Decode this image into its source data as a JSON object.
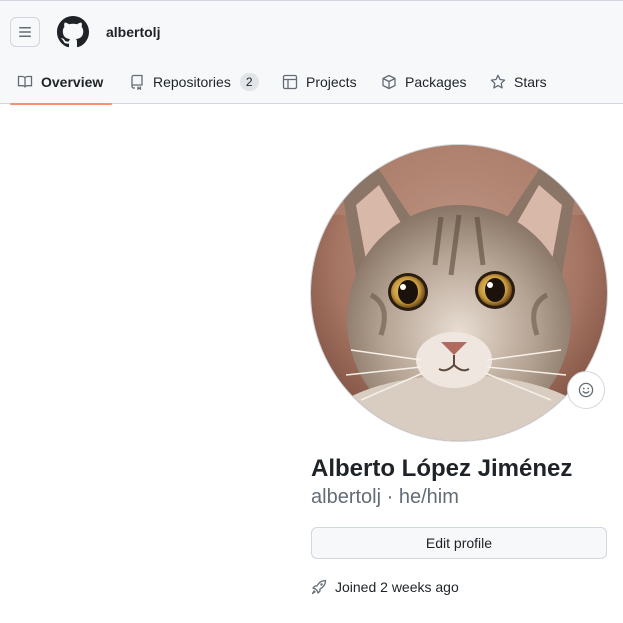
{
  "header": {
    "username": "albertolj",
    "menu_icon": "hamburger-icon",
    "logo_icon": "github-mark-icon"
  },
  "tabs": [
    {
      "label": "Overview",
      "icon": "book-icon",
      "active": true
    },
    {
      "label": "Repositories",
      "icon": "repo-icon",
      "count": "2"
    },
    {
      "label": "Projects",
      "icon": "table-icon"
    },
    {
      "label": "Packages",
      "icon": "package-icon"
    },
    {
      "label": "Stars",
      "icon": "star-icon"
    }
  ],
  "profile": {
    "full_name": "Alberto López Jiménez",
    "login": "albertolj",
    "separator": "·",
    "pronouns": "he/him",
    "edit_label": "Edit profile",
    "joined": "Joined 2 weeks ago",
    "avatar_subject": "tabby kitten photo",
    "status_icon": "smiley-icon"
  },
  "colors": {
    "accent_underline": "#fd8c73",
    "header_bg": "#f6f8fa",
    "text": "#1f2328",
    "muted": "#636c76"
  }
}
